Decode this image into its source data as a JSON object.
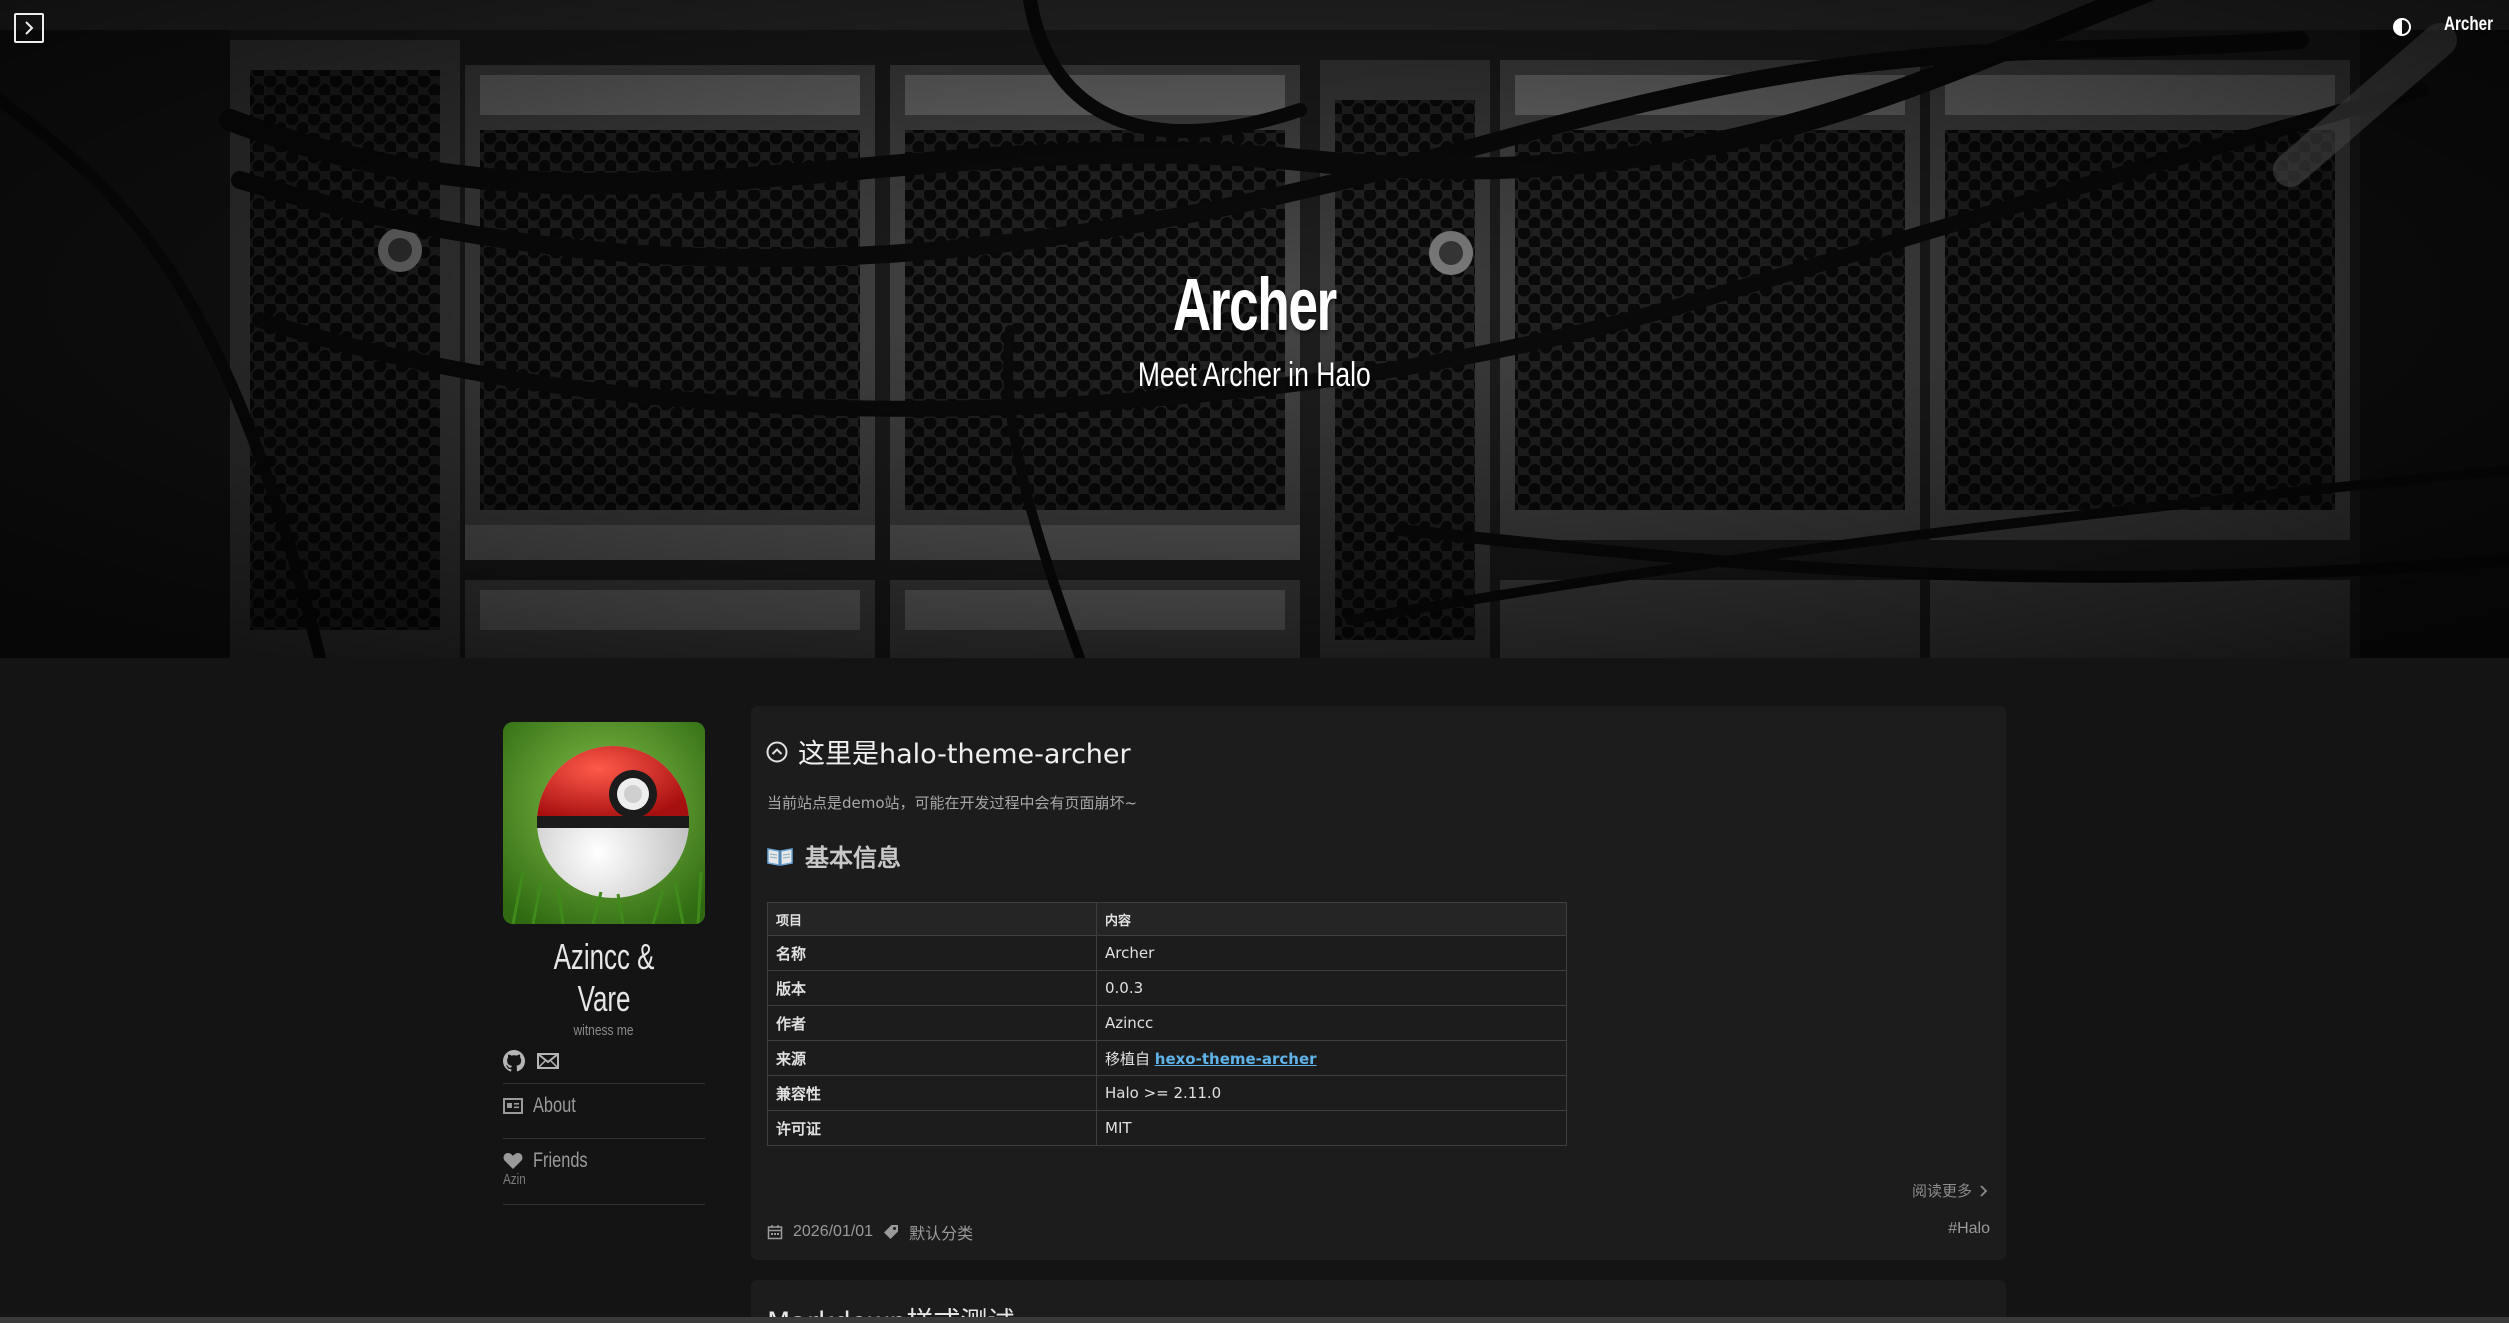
{
  "header": {
    "site_title": "Archer",
    "site_subtitle": "Meet Archer in Halo",
    "brand_link": "Archer"
  },
  "sidebar": {
    "author_name": "Azincc & Vare",
    "author_bio": "witness me",
    "items": [
      {
        "label": "About",
        "icon": "id-card-icon"
      },
      {
        "label": "Friends",
        "icon": "heart-icon",
        "sub": "Azin"
      }
    ]
  },
  "post": {
    "title": "这里是halo-theme-archer",
    "description": "当前站点是demo站，可能在开发过程中会有页面崩坏~",
    "section_heading": "基本信息",
    "table": {
      "headers": [
        "项目",
        "内容"
      ],
      "rows": [
        {
          "key": "名称",
          "value": "Archer"
        },
        {
          "key": "版本",
          "value": "0.0.3"
        },
        {
          "key": "作者",
          "value": "Azincc"
        },
        {
          "key": "来源",
          "value": "移植自 ",
          "link": "hexo-theme-archer"
        },
        {
          "key": "兼容性",
          "value": "Halo >= 2.11.0"
        },
        {
          "key": "许可证",
          "value": "MIT"
        }
      ]
    },
    "read_more": "阅读更多",
    "date": "2026/01/01",
    "category": "默认分类",
    "tag": "#Halo"
  },
  "next_post": {
    "title": "Markdown样式测试"
  },
  "colors": {
    "background": "#141414",
    "card": "#1c1c1c",
    "link": "#5fb3e8"
  }
}
